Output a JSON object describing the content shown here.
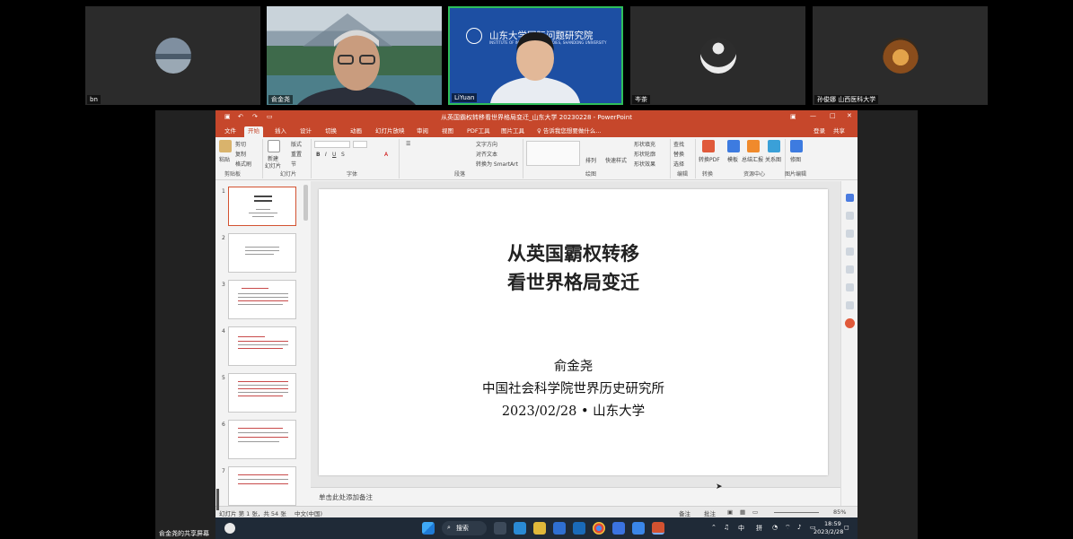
{
  "participants": [
    {
      "name": "bn"
    },
    {
      "name": "俞金尧"
    },
    {
      "name": "LiYuan",
      "banner": "山东大学国际问题研究院",
      "banner_en": "INSTITUTE OF INTERNATIONAL STUDIES, SHANDONG UNIVERSITY"
    },
    {
      "name": "岑茶"
    },
    {
      "name": "孙俊娜 山西医科大学"
    }
  ],
  "ppt": {
    "window_title": "从英国霸权转移看世界格局变迁_山东大学 20230228 - PowerPoint",
    "signin": "登录",
    "share": "共享",
    "tabs": [
      "文件",
      "开始",
      "插入",
      "设计",
      "切换",
      "动画",
      "幻灯片放映",
      "审阅",
      "视图",
      "PDF工具",
      "图片工具",
      "♀ 告诉我您想要做什么..."
    ],
    "active_tab": 1,
    "ribbon": {
      "paste": "粘贴",
      "cut": "剪切",
      "copy": "复制",
      "format_painter": "格式刷",
      "new_slide_1": "新建",
      "new_slide_2": "幻灯片",
      "layout": "版式",
      "reset": "重置",
      "section": "节",
      "text_direction": "文字方向",
      "align_text": "对齐文本",
      "smartart": "转换为 SmartArt",
      "arrange": "排列",
      "quick_styles": "快速样式",
      "shape_fill": "形状填充",
      "shape_outline": "形状轮廓",
      "shape_effects": "形状效果",
      "find": "查找",
      "replace": "替换",
      "select": "选择",
      "to_pdf": "转换PDF",
      "template": "模板",
      "summary": "总结汇报",
      "relation": "关系图",
      "image": "修图",
      "groups": [
        "剪贴板",
        "幻灯片",
        "字体",
        "段落",
        "绘图",
        "编辑",
        "转换",
        "资源中心",
        "图片编辑"
      ]
    },
    "thumbs": [
      "1",
      "2",
      "3",
      "4",
      "5",
      "6",
      "7"
    ],
    "slide": {
      "title1": "从英国霸权转移",
      "title2": "看世界格局变迁",
      "author": "俞金尧",
      "affiliation": "中国社会科学院世界历史研究所",
      "date_place": "2023/02/28 • 山东大学"
    },
    "notes_placeholder": "单击此处添加备注",
    "status": {
      "slide_count": "幻灯片 第 1 张，共 54 张",
      "language": "中文(中国)",
      "notes": "备注",
      "comments": "批注",
      "zoom": "85%"
    }
  },
  "taskbar": {
    "search": "搜索",
    "ime_cn": "中",
    "ime_pin": "拼",
    "time": "18:59",
    "date": "2023/2/28"
  },
  "presenter_label": "俞金尧的共享屏幕",
  "colors": {
    "accent": "#c6472b",
    "taskbar": "#1f2a37"
  }
}
